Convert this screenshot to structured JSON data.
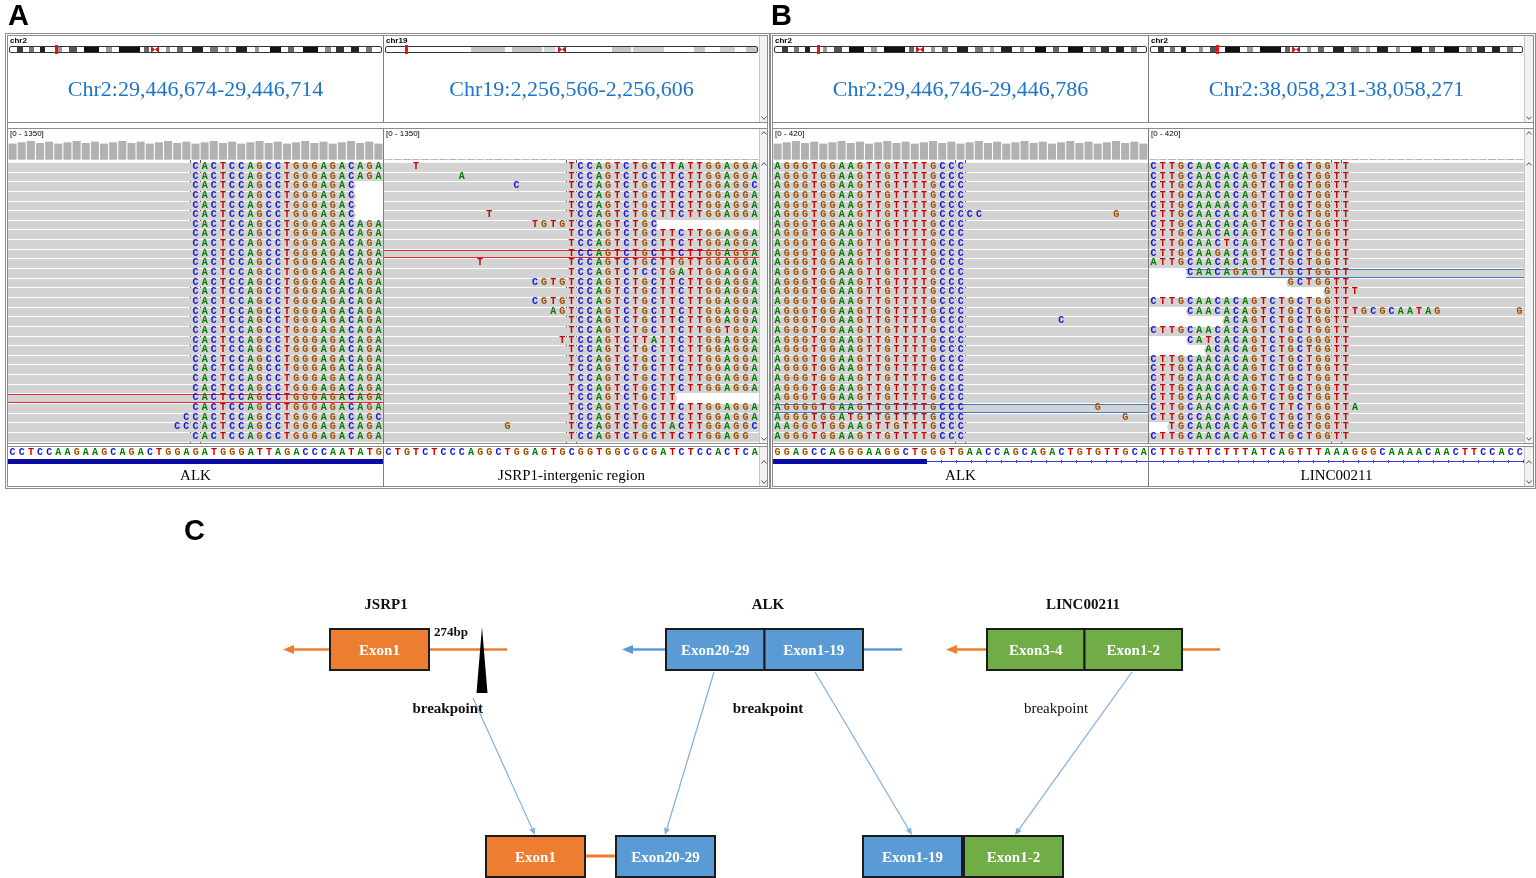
{
  "panels": [
    {
      "label": "A",
      "color": "#e8262b",
      "panes": [
        {
          "chromosome": "chr2",
          "ideogram": {
            "kind": "banded",
            "level": 0.125
          },
          "locus": "Chr2:29,446,674-29,446,714",
          "coverage": {
            "range": "[0 - 1350]",
            "kind": "dense"
          },
          "reads": [
            {
              "bases": [
                "                    CACTCCAGCCTGGGAGACAGA"
              ],
              "read_start": false,
              "read_end": false,
              "outlined": false
            },
            {
              "bases": [
                "                    CACTCCAGCCTGGGAGACAGA"
              ],
              "read_start": false,
              "read_end": false,
              "outlined": false
            },
            {
              "bases": [
                "                    CACTCCAGCCTGGGAGAC"
              ],
              "read_start": false,
              "read_end": true,
              "outlined": false
            },
            {
              "bases": [
                "                    CACTCCAGCCTGGGAGAC"
              ],
              "read_start": false,
              "read_end": true,
              "outlined": false
            },
            {
              "bases": [
                "                    CACTCCAGCCTGGGAGAC"
              ],
              "read_start": false,
              "read_end": true,
              "outlined": false
            },
            {
              "bases": [
                "                    CACTCCAGCCTGGGAGAC"
              ],
              "read_start": false,
              "read_end": true,
              "outlined": false
            },
            {
              "bases": [
                "                    CACTCCAGCCTGGGAGACAGA"
              ],
              "read_start": false,
              "read_end": false,
              "outlined": false
            },
            {
              "bases": [
                "                    CACTCCAGCCTGGGAGACAGA"
              ],
              "read_start": false,
              "read_end": false,
              "outlined": false
            },
            {
              "bases": [
                "                    CACTCCAGCCTGGGAGACAGA"
              ],
              "read_start": false,
              "read_end": false,
              "outlined": false
            },
            {
              "bases": [
                "                    CACTCCAGCCTGGGAGACAGA"
              ],
              "read_start": false,
              "read_end": false,
              "outlined": false
            },
            {
              "bases": [
                "                    CACTCCAGCCTGGGAGACAGA"
              ],
              "read_start": false,
              "read_end": false,
              "outlined": false
            },
            {
              "bases": [
                "                    CACTCCAGCCTGGGAGACAGA"
              ],
              "read_start": false,
              "read_end": false,
              "outlined": false
            },
            {
              "bases": [
                "                    CACTCCAGCCTGGGAGACAGA"
              ],
              "read_start": false,
              "read_end": false,
              "outlined": false
            },
            {
              "bases": [
                "                    CACTCCAGCCTGGGAGACAGA"
              ],
              "read_start": false,
              "read_end": false,
              "outlined": false
            },
            {
              "bases": [
                "                    CACTCCAGCCTGGGAGACAGA"
              ],
              "read_start": false,
              "read_end": false,
              "outlined": false
            },
            {
              "bases": [
                "                    CACTCCAGCCTGGGAGACAGA"
              ],
              "read_start": false,
              "read_end": false,
              "outlined": false
            },
            {
              "bases": [
                "                    CACTCCAGCCTGGGAGACAGA"
              ],
              "read_start": false,
              "read_end": false,
              "outlined": false
            },
            {
              "bases": [
                "                    CACTCCAGCCTGGGAGACAGA"
              ],
              "read_start": false,
              "read_end": false,
              "outlined": false
            },
            {
              "bases": [
                "                    CACTCCAGCCTGGGAGACAGA"
              ],
              "read_start": false,
              "read_end": false,
              "outlined": false
            },
            {
              "bases": [
                "                    CACTCCAGCCTGGGAGACAGA"
              ],
              "read_start": false,
              "read_end": false,
              "outlined": false
            },
            {
              "bases": [
                "                    CACTCCAGCCTGGGAGACAGA"
              ],
              "read_start": false,
              "read_end": false,
              "outlined": false
            },
            {
              "bases": [
                "                    CACTCCAGCCTGGGAGACAGA"
              ],
              "read_start": false,
              "read_end": false,
              "outlined": false
            },
            {
              "bases": [
                "                    CACTCCAGCCTGGGAGACAGA"
              ],
              "read_start": false,
              "read_end": false,
              "outlined": false
            },
            {
              "bases": [
                "                    CACTCCAGCCTGGGAGACAGA"
              ],
              "read_start": false,
              "read_end": false,
              "outlined": false
            },
            {
              "bases": [
                "                    CACTCCAGCCTGGGAGACAGA"
              ],
              "read_start": false,
              "read_end": false,
              "outlined": true
            },
            {
              "bases": [
                "                    CACTCCAGCCTGGGAGACAGA"
              ],
              "read_start": false,
              "read_end": false,
              "outlined": false
            },
            {
              "bases": [
                "                   CCACTCCAGCCTGGGAGACAGC"
              ],
              "read_start": false,
              "read_end": false,
              "outlined": false
            },
            {
              "bases": [
                "                  CCCACTCCAGCCTGGGAGACAGA"
              ],
              "read_start": false,
              "read_end": false,
              "outlined": false
            },
            {
              "bases": [
                "                    CACTCCAGCCTGGGAGACAGA"
              ],
              "read_start": false,
              "read_end": false,
              "outlined": false
            }
          ],
          "reference": "CCTCCAAGAAGCAGACTGGAGATGGGATTAGACCCAATATG",
          "gene": {
            "name": "ALK",
            "exon_bar": true
          }
        },
        {
          "chromosome": "chr19",
          "ideogram": {
            "kind": "pale",
            "level": 0.056
          },
          "locus": "Chr19:2,256,566-2,256,606",
          "coverage": {
            "range": "[0 - 1350]",
            "kind": "sparse"
          },
          "reads": [
            {
              "bases": [
                "   T",
                "                TCCAGTCTGCTTATTGGAGGA"
              ],
              "read_start": false,
              "read_end": false,
              "outlined": false
            },
            {
              "bases": [
                "        A",
                "           TCCAGTCTCCTTCTTGGAGGA"
              ],
              "read_start": false,
              "read_end": false,
              "outlined": false
            },
            {
              "bases": [
                "              C",
                "     TCCAGTCTGCTTCTTGGAGGC"
              ],
              "read_start": false,
              "read_end": false,
              "outlined": false
            },
            {
              "bases": [
                "                    TCCAGTCTGCTTCTTGGAGGA"
              ],
              "read_start": false,
              "read_end": false,
              "outlined": false
            },
            {
              "bases": [
                "                    TCCAGTCTGCTTCTTGGAGGA"
              ],
              "read_start": false,
              "read_end": false,
              "outlined": false
            },
            {
              "bases": [
                "           T",
                "        TCCAGTCTGCTTCTTGGAGGA"
              ],
              "read_start": false,
              "read_end": false,
              "outlined": false
            },
            {
              "bases": [
                "                TGTGTCCAGTCTGC"
              ],
              "read_start": false,
              "read_end": true,
              "outlined": false
            },
            {
              "bases": [
                "                    TCCAGTCTGCTTCTTGGAGGA"
              ],
              "read_start": false,
              "read_end": false,
              "outlined": false
            },
            {
              "bases": [
                "                    TCCAGTCTGCTTCTTGGAGGA"
              ],
              "read_start": false,
              "read_end": false,
              "outlined": false
            },
            {
              "bases": [
                "                    TCCAGTCTGCTTCTTGGAGGA"
              ],
              "read_start": false,
              "read_end": false,
              "outlined": true
            },
            {
              "bases": [
                "          T",
                "         TCCAGTCTGCTTGTTGGAGGA"
              ],
              "read_start": false,
              "read_end": false,
              "outlined": false
            },
            {
              "bases": [
                "                    TCCAGTCTCCTGATTGGAGGA"
              ],
              "read_start": false,
              "read_end": false,
              "outlined": false
            },
            {
              "bases": [
                "                CGTGTCCAGTCTGCTTCTTGGAGGA"
              ],
              "read_start": false,
              "read_end": false,
              "outlined": false
            },
            {
              "bases": [
                "                    TCCAGTCTGCTTCTTGGAGGA"
              ],
              "read_start": false,
              "read_end": false,
              "outlined": false
            },
            {
              "bases": [
                "                CGTGTCCAGTCTGCTTCTTGGAGGA"
              ],
              "read_start": false,
              "read_end": false,
              "outlined": false
            },
            {
              "bases": [
                "                  AGTCCAGTCTGCTTCTTGGAGGA"
              ],
              "read_start": false,
              "read_end": false,
              "outlined": false
            },
            {
              "bases": [
                "                    TCCAGTCTGCTTCTTGGAGGA"
              ],
              "read_start": false,
              "read_end": false,
              "outlined": false
            },
            {
              "bases": [
                "                    TCCAGTCTGCTTCTTGGTGGA"
              ],
              "read_start": false,
              "read_end": false,
              "outlined": false
            },
            {
              "bases": [
                "                   TTCCAGTCTTATTCTTGGAGGA"
              ],
              "read_start": false,
              "read_end": false,
              "outlined": false
            },
            {
              "bases": [
                "                    TCCAGTCTGCTTCTTGGAGGA"
              ],
              "read_start": false,
              "read_end": false,
              "outlined": false
            },
            {
              "bases": [
                "                    TCCAGTCTGCTTCTTGGAGGA"
              ],
              "read_start": false,
              "read_end": false,
              "outlined": false
            },
            {
              "bases": [
                "                    TCCAGTCTGCTTCTTGGAGGA"
              ],
              "read_start": false,
              "read_end": false,
              "outlined": false
            },
            {
              "bases": [
                "                    TCCAGTCTGCTTCTTGGAGGA"
              ],
              "read_start": false,
              "read_end": false,
              "outlined": false
            },
            {
              "bases": [
                "                    TCCAGTCTGCTTCTTGGAGGA"
              ],
              "read_start": false,
              "read_end": false,
              "outlined": false
            },
            {
              "bases": [
                "                    TCCAGTCTGCTT"
              ],
              "read_start": false,
              "read_end": true,
              "outlined": false
            },
            {
              "bases": [
                "                    TCCAGTCTGCTTCTTGGAGGA"
              ],
              "read_start": false,
              "read_end": false,
              "outlined": false
            },
            {
              "bases": [
                "                    TCCAGTCTGCTTCTTGGAGGA"
              ],
              "read_start": false,
              "read_end": false,
              "outlined": false
            },
            {
              "bases": [
                "             G",
                "      TCCAGTCTGCTACTTGGAGGC"
              ],
              "read_start": false,
              "read_end": false,
              "outlined": false
            },
            {
              "bases": [
                "                    TCCAGTCTGCTTCTTGGAGG"
              ],
              "read_start": false,
              "read_end": false,
              "outlined": false
            }
          ],
          "reference": "CTGTCTCCCAGGCTGGAGTGCGGTGGCGCGATCTCCACTCA",
          "gene": {
            "name": "JSRP1-intergenic region"
          }
        }
      ]
    },
    {
      "label": "B",
      "color": "#3d7cc4",
      "panes": [
        {
          "chromosome": "chr2",
          "ideogram": {
            "kind": "banded",
            "level": 0.117
          },
          "locus": "Chr2:29,446,746-29,446,786",
          "coverage": {
            "range": "[0 - 420]",
            "kind": "dense"
          },
          "reads": [
            {
              "bases": [
                "AGGGTGGAAGTTGTTTTGCCC"
              ],
              "read_start": false,
              "read_end": false,
              "outlined": false
            },
            {
              "bases": [
                "AGGGTGGAAGTTGTTTTGCCC"
              ],
              "read_start": false,
              "read_end": false,
              "outlined": false
            },
            {
              "bases": [
                "AGGGTGGAAGTTGTTTTGCCC"
              ],
              "read_start": false,
              "read_end": false,
              "outlined": false
            },
            {
              "bases": [
                "AGGGTGGAAGTTGTTTTGCCC"
              ],
              "read_start": false,
              "read_end": false,
              "outlined": false
            },
            {
              "bases": [
                "AGGGTGGAAGTTGTTTTGCCC"
              ],
              "read_start": false,
              "read_end": false,
              "outlined": false
            },
            {
              "bases": [
                "AGGGTGGAAGTTGTTTTGCCCCC",
                "              G"
              ],
              "read_start": false,
              "read_end": false,
              "outlined": false
            },
            {
              "bases": [
                "AGGGTGGAAGTTGTTTTGCCC"
              ],
              "read_start": false,
              "read_end": false,
              "outlined": false
            },
            {
              "bases": [
                "AGGGTGGAAGTTGTTTTGCCC"
              ],
              "read_start": false,
              "read_end": false,
              "outlined": false
            },
            {
              "bases": [
                "AGGGTGGAAGTTGTTTTGCCC"
              ],
              "read_start": false,
              "read_end": false,
              "outlined": false
            },
            {
              "bases": [
                "AGGGTGGAAGTTGTTTTGCCC"
              ],
              "read_start": false,
              "read_end": false,
              "outlined": false
            },
            {
              "bases": [
                "AGGGTGGAAGTTGTTTTGCCC"
              ],
              "read_start": false,
              "read_end": false,
              "outlined": false
            },
            {
              "bases": [
                "AGGGTGGAAGTTGTTTTGCCC"
              ],
              "read_start": false,
              "read_end": false,
              "outlined": false
            },
            {
              "bases": [
                "AGGGTGGAAGTTGTTTTGCCC"
              ],
              "read_start": false,
              "read_end": false,
              "outlined": false
            },
            {
              "bases": [
                "AGGGTGGAAGTTGTTTTGCCC"
              ],
              "read_start": false,
              "read_end": false,
              "outlined": false
            },
            {
              "bases": [
                "AGGGTGGAAGTTGTTTTGCCC"
              ],
              "read_start": false,
              "read_end": false,
              "outlined": false
            },
            {
              "bases": [
                "AGGGTGGAAGTTGTTTTGCCC"
              ],
              "read_start": false,
              "read_end": false,
              "outlined": false
            },
            {
              "bases": [
                "AGGGTGGAAGTTGTTTTGCCC",
                "          C"
              ],
              "read_start": false,
              "read_end": false,
              "outlined": false
            },
            {
              "bases": [
                "AGGGTGGAAGTTGTTTTGCCC"
              ],
              "read_start": false,
              "read_end": false,
              "outlined": false
            },
            {
              "bases": [
                "AGGGTGGAAGTTGTTTTGCCC"
              ],
              "read_start": false,
              "read_end": false,
              "outlined": false
            },
            {
              "bases": [
                "AGGGTGGAAGTTGTTTTGCCC"
              ],
              "read_start": false,
              "read_end": false,
              "outlined": false
            },
            {
              "bases": [
                "AGGGTGGAAGTTGTTTTGCCC"
              ],
              "read_start": false,
              "read_end": false,
              "outlined": false
            },
            {
              "bases": [
                "AGGGTGGAAGTTGTTTTGCCC"
              ],
              "read_start": false,
              "read_end": false,
              "outlined": false
            },
            {
              "bases": [
                "AGGGTGGAAGTTGTTTTGCCC"
              ],
              "read_start": false,
              "read_end": false,
              "outlined": false
            },
            {
              "bases": [
                "AGGGTGGAAGTTGTTTTGCCC"
              ],
              "read_start": false,
              "read_end": false,
              "outlined": false
            },
            {
              "bases": [
                "AGGGTGGAAGTTGTTTTGCCC"
              ],
              "read_start": false,
              "read_end": false,
              "outlined": false
            },
            {
              "bases": [
                "AGGGGTGAAGTTGTTTTGCCC",
                "              G"
              ],
              "read_start": false,
              "read_end": false,
              "outlined": true
            },
            {
              "bases": [
                "AGGGTGGATGTTGTTTTGCCC",
                "                 G"
              ],
              "read_start": false,
              "read_end": false,
              "outlined": false
            },
            {
              "bases": [
                "AAGGGTGGAAGTTGTTTGCCC"
              ],
              "read_start": false,
              "read_end": false,
              "outlined": false
            },
            {
              "bases": [
                "AGGGTGGAAGTTGTTTTGCCC"
              ],
              "read_start": false,
              "read_end": false,
              "outlined": false
            }
          ],
          "reference": "GGAGCCAGGGAAGGCTGGGTGAACCAGCAGACTGTGTTGCA",
          "gene": {
            "name": "ALK",
            "level": 0.41,
            "intron_line": true
          }
        },
        {
          "chromosome": "chr2",
          "ideogram": {
            "kind": "banded",
            "level": 0.18
          },
          "locus": "Chr2:38,058,231-38,058,271",
          "coverage": {
            "range": "[0 - 420]",
            "kind": "sparse"
          },
          "reads": [
            {
              "bases": [
                "CTTGCAACACAGTCTGCTGGTT"
              ],
              "read_start": false,
              "read_end": false,
              "outlined": false
            },
            {
              "bases": [
                "CTTGCAACACAGTCTGCTGGTT"
              ],
              "read_start": false,
              "read_end": false,
              "outlined": false
            },
            {
              "bases": [
                "CTTGCAACACAGTCTGCTGGTT"
              ],
              "read_start": false,
              "read_end": false,
              "outlined": false
            },
            {
              "bases": [
                "CTTGCAACACAGTCTGCTGGTT"
              ],
              "read_start": false,
              "read_end": false,
              "outlined": false
            },
            {
              "bases": [
                "CTTGCAAAACAGTCTGCTGGTT"
              ],
              "read_start": false,
              "read_end": false,
              "outlined": false
            },
            {
              "bases": [
                "CTTGCAACACAGTCTGCTGGTT"
              ],
              "read_start": false,
              "read_end": false,
              "outlined": false
            },
            {
              "bases": [
                "CTTGCAACACAGTCTGCTGGTT"
              ],
              "read_start": false,
              "read_end": false,
              "outlined": false
            },
            {
              "bases": [
                "CTTGCAACACAGTCTGCTGGTT"
              ],
              "read_start": false,
              "read_end": false,
              "outlined": false
            },
            {
              "bases": [
                "CTTGCAACTCAGTCTGCTGGTT"
              ],
              "read_start": false,
              "read_end": false,
              "outlined": false
            },
            {
              "bases": [
                "CTTGCAAGACAGTCTGCTGGTT"
              ],
              "read_start": false,
              "read_end": false,
              "outlined": false
            },
            {
              "bases": [
                "ATTGCAACACAGTCTGCTGGTT"
              ],
              "read_start": false,
              "read_end": false,
              "outlined": false
            },
            {
              "bases": [
                "    CAACAGAGTCTGCTGGTT"
              ],
              "read_start": true,
              "read_end": false,
              "outlined": true
            },
            {
              "bases": [
                "               GCTGGTT"
              ],
              "read_start": true,
              "read_end": false,
              "outlined": false
            },
            {
              "bases": [
                "                   GTTT"
              ],
              "read_start": true,
              "read_end": false,
              "outlined": false
            },
            {
              "bases": [
                "CTTGCAACACAGTCTGCTGGTT"
              ],
              "read_start": false,
              "read_end": false,
              "outlined": false
            },
            {
              "bases": [
                "    CAACACAGTCTGCTGGTTTGCGCAATAG",
                "        G"
              ],
              "read_start": true,
              "read_end": false,
              "outlined": false
            },
            {
              "bases": [
                "        ACAGTCTGCTGGTT"
              ],
              "read_start": true,
              "read_end": false,
              "outlined": false
            },
            {
              "bases": [
                "CTTGCAACACAGTCTGCTGGTT"
              ],
              "read_start": false,
              "read_end": false,
              "outlined": false
            },
            {
              "bases": [
                "    CATCACAGTCTGCGGGTT"
              ],
              "read_start": true,
              "read_end": false,
              "outlined": false
            },
            {
              "bases": [
                "      ACACAGTCTGCTGGTT"
              ],
              "read_start": true,
              "read_end": false,
              "outlined": false
            },
            {
              "bases": [
                "CTTGCAACACAGTCTGCTGGTT"
              ],
              "read_start": false,
              "read_end": false,
              "outlined": false
            },
            {
              "bases": [
                "CTTGCAACACAGTCTGCTGGTT"
              ],
              "read_start": false,
              "read_end": false,
              "outlined": false
            },
            {
              "bases": [
                "CTTGCAACACAGTCTGCTGGTT"
              ],
              "read_start": false,
              "read_end": false,
              "outlined": false
            },
            {
              "bases": [
                "CTTGCAACACAGTCTGCTGGTT"
              ],
              "read_start": false,
              "read_end": false,
              "outlined": false
            },
            {
              "bases": [
                "CTTGCAACACAGTCTGCTGGTT"
              ],
              "read_start": false,
              "read_end": false,
              "outlined": false
            },
            {
              "bases": [
                "CTTGCAACACAGTCTTCTGGTTA"
              ],
              "read_start": false,
              "read_end": false,
              "outlined": false
            },
            {
              "bases": [
                "CTTGCCACACAGTCTGCTGGTT"
              ],
              "read_start": false,
              "read_end": false,
              "outlined": false
            },
            {
              "bases": [
                "  TGCAACACAGTCTGCTGGTT"
              ],
              "read_start": true,
              "read_end": false,
              "outlined": false
            },
            {
              "bases": [
                "CTTGCAACACAGTCTGCTGGTT"
              ],
              "read_start": false,
              "read_end": false,
              "outlined": false
            }
          ],
          "reference": "CTTGTTTCTTTATCAGTTTAAAGGGCAAAACAACTTCCACC",
          "gene": {
            "name": "LINC00211",
            "intron_line": true
          }
        }
      ]
    }
  ],
  "diagram": {
    "label": "C",
    "genes": [
      {
        "name": "JSRP1",
        "color": "#ed7d31"
      },
      {
        "name": "ALK",
        "color": "#5b9bd5"
      },
      {
        "name": "LINC00211",
        "color": "#ed7d31"
      }
    ],
    "distance": "274bp",
    "gene_models": [
      {
        "breakpoint_marker": true,
        "exons": [
          {
            "label": "Exon1",
            "color": "#ed7d31"
          }
        ]
      },
      {
        "breakpoint_marker": false,
        "exons": [
          {
            "label": "Exon20-29",
            "color": "#5b9bd5"
          },
          {
            "label": "Exon1-19",
            "color": "#5b9bd5"
          }
        ]
      },
      {
        "breakpoint_marker": false,
        "exons": [
          {
            "label": "Exon3-4",
            "color": "#70ad47"
          },
          {
            "label": "Exon1-2",
            "color": "#70ad47"
          }
        ]
      }
    ],
    "breakpoints": [
      {
        "label": "breakpoint",
        "bold": true
      },
      {
        "label": "breakpoint",
        "bold": true
      },
      {
        "label": "breakpoint",
        "bold": false
      }
    ],
    "fusions": [
      {
        "linked": true,
        "exons": [
          {
            "label": "Exon1",
            "color": "#ed7d31"
          },
          {
            "label": "Exon20-29",
            "color": "#5b9bd5"
          }
        ]
      },
      {
        "linked": false,
        "exons": [
          {
            "label": "Exon1-19",
            "color": "#5b9bd5"
          },
          {
            "label": "Exon1-2",
            "color": "#70ad47"
          }
        ]
      }
    ]
  }
}
